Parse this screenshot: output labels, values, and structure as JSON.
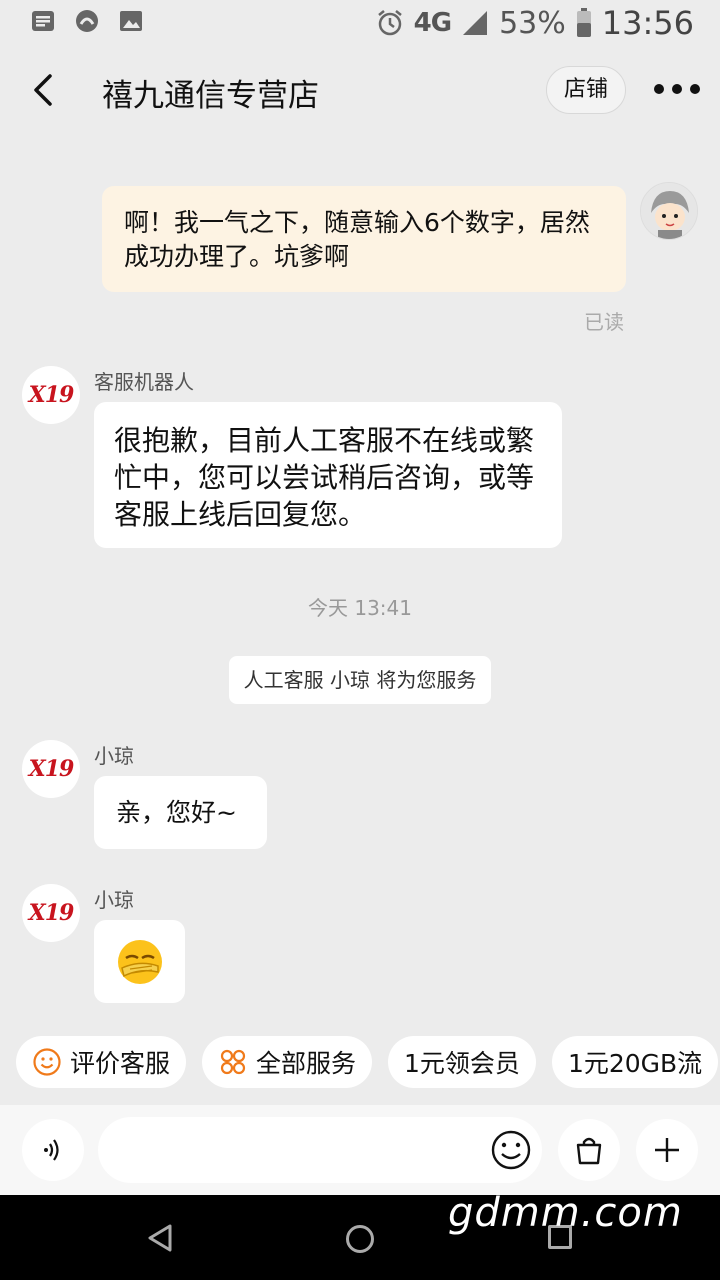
{
  "status_bar": {
    "network": "4G",
    "battery": "53%",
    "time": "13:56"
  },
  "header": {
    "title": "禧九通信专营店",
    "shop_button": "店铺"
  },
  "messages": {
    "me_text": "啊！我一气之下，随意输入6个数字，居然成功办理了。坑爹啊",
    "read_status": "已读",
    "bot_sender": "客服机器人",
    "bot_text": "很抱歉，目前人工客服不在线或繁忙中，您可以尝试稍后咨询，或等客服上线后回复您。",
    "time_label": "今天 13:41",
    "system_notice": "人工客服 小琼 将为您服务",
    "agent_sender_1": "小琼",
    "agent_text_1": "亲，您好~",
    "agent_sender_2": "小琼",
    "shop_logo_text": "X19"
  },
  "quick_replies": [
    {
      "label": "评价客服",
      "icon": "smile-icon"
    },
    {
      "label": "全部服务",
      "icon": "grid-icon"
    },
    {
      "label": "1元领会员"
    },
    {
      "label": "1元20GB流"
    }
  ],
  "input_bar": {
    "placeholder": ""
  },
  "watermark": "gdmm.com",
  "colors": {
    "my_bubble": "#fdf3e3",
    "background": "#ececec",
    "accent_orange": "#f07a1a",
    "logo_red": "#c8141e"
  }
}
